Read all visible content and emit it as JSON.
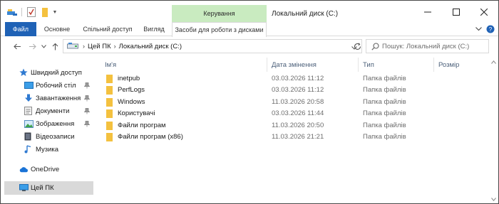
{
  "window": {
    "title": "Локальний диск (C:)",
    "contextual_tab_group": "Керування"
  },
  "ribbon": {
    "tabs": [
      {
        "label": "Файл"
      },
      {
        "label": "Основне"
      },
      {
        "label": "Спільний доступ"
      },
      {
        "label": "Вигляд"
      },
      {
        "label": "Засоби для роботи з дисками"
      }
    ]
  },
  "address": {
    "breadcrumb": [
      "Цей ПК",
      "Локальний диск (C:)"
    ]
  },
  "search": {
    "placeholder": "Пошук: Локальний диск (C:)"
  },
  "nav": {
    "items": [
      {
        "label": "Швидкий доступ",
        "icon": "star-icon",
        "pinned": false
      },
      {
        "label": "Робочий стіл",
        "icon": "desktop-icon",
        "pinned": true
      },
      {
        "label": "Завантаження",
        "icon": "download-icon",
        "pinned": true
      },
      {
        "label": "Документи",
        "icon": "documents-icon",
        "pinned": true
      },
      {
        "label": "Зображення",
        "icon": "pictures-icon",
        "pinned": true
      },
      {
        "label": "Відеозаписи",
        "icon": "videos-icon",
        "pinned": false
      },
      {
        "label": "Музика",
        "icon": "music-icon",
        "pinned": false
      },
      {
        "label": "OneDrive",
        "icon": "onedrive-icon",
        "pinned": false
      },
      {
        "label": "Цей ПК",
        "icon": "this-pc-icon",
        "pinned": false
      }
    ],
    "selected": "Цей ПК"
  },
  "columns": {
    "name": "Ім'я",
    "date": "Дата змінення",
    "type": "Тип",
    "size": "Розмір"
  },
  "files": [
    {
      "name": "inetpub",
      "date": "03.03.2026 11:12",
      "type": "Папка файлів"
    },
    {
      "name": "PerfLogs",
      "date": "03.03.2026 11:12",
      "type": "Папка файлів"
    },
    {
      "name": "Windows",
      "date": "11.03.2026 20:58",
      "type": "Папка файлів"
    },
    {
      "name": "Користувачі",
      "date": "03.03.2026 11:44",
      "type": "Папка файлів"
    },
    {
      "name": "Файли програм",
      "date": "11.03.2026 20:50",
      "type": "Папка файлів"
    },
    {
      "name": "Файли програм (x86)",
      "date": "11.03.2026 21:21",
      "type": "Папка файлів"
    }
  ],
  "colors": {
    "file_tab": "#1f62b6",
    "context_tab": "#c9ebc0",
    "folder": "#f4c13f",
    "selection": "#d9d9d9",
    "header_text": "#4c607a"
  }
}
